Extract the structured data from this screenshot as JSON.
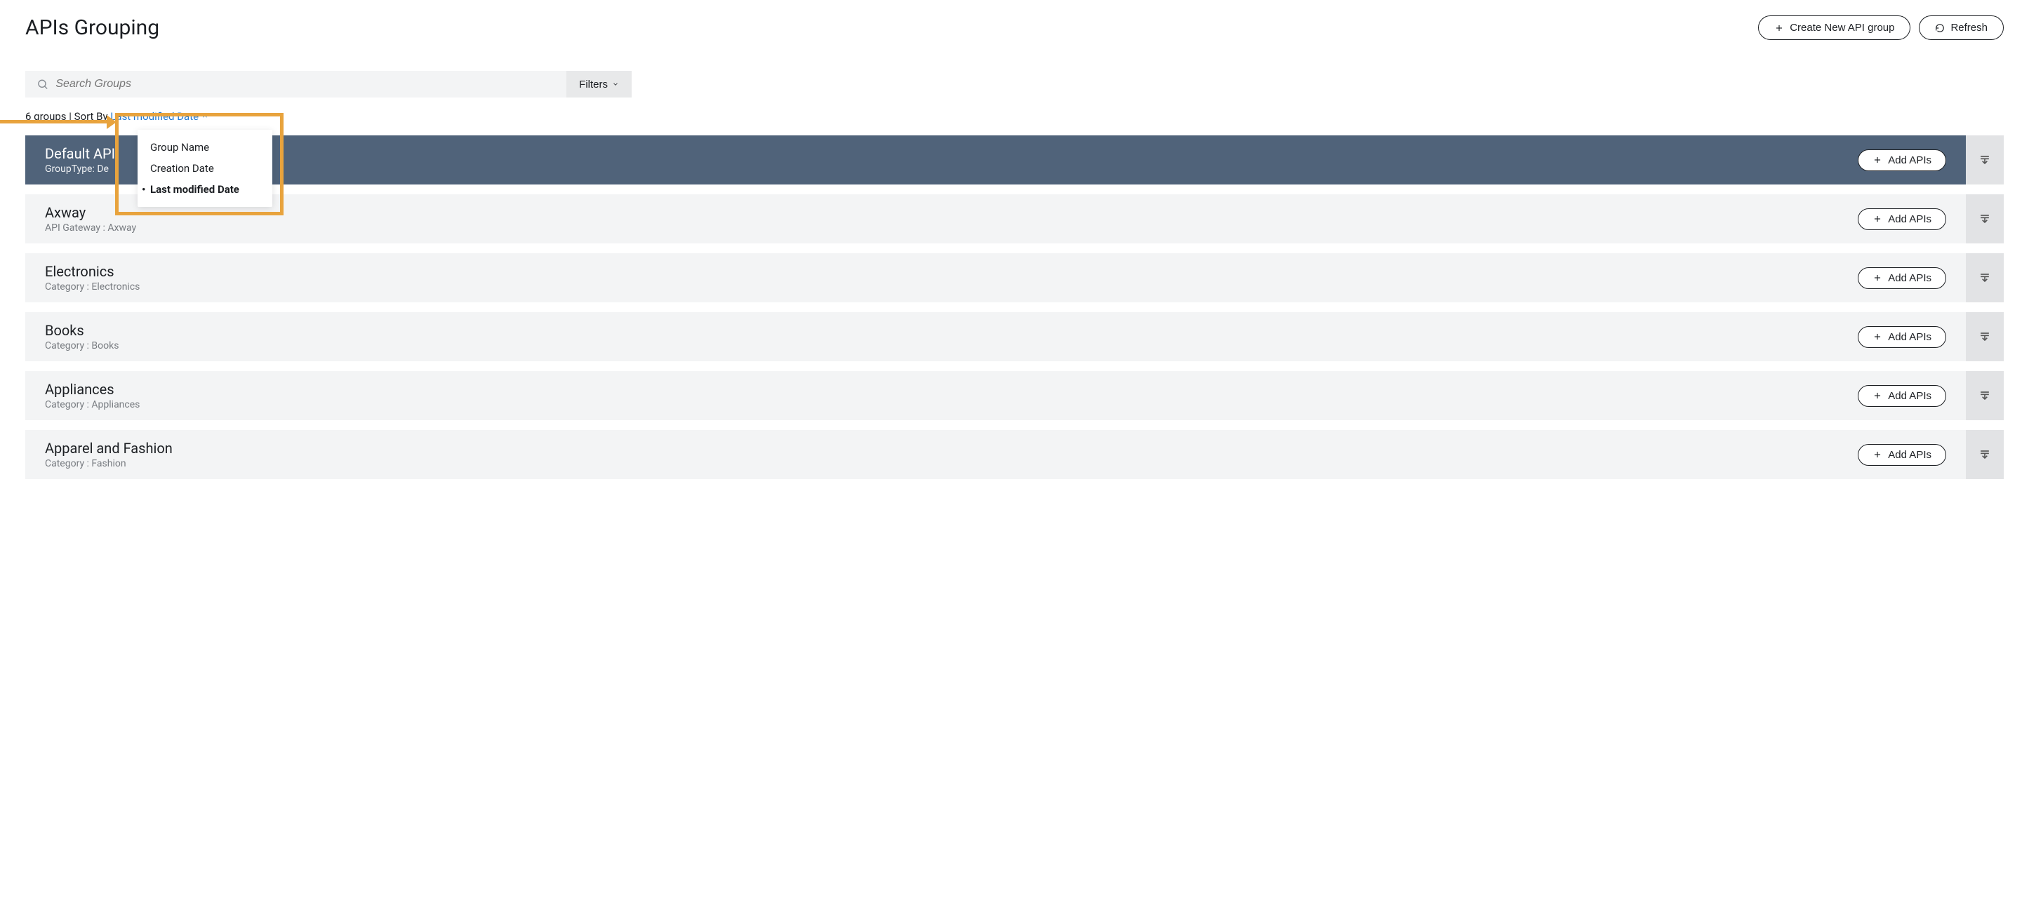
{
  "header": {
    "title": "APIs Grouping",
    "create_label": "Create New API group",
    "refresh_label": "Refresh"
  },
  "search": {
    "placeholder": "Search Groups",
    "filters_label": "Filters"
  },
  "sort": {
    "count_text": "6 groups | Sort By",
    "current": "Last modified Date",
    "options": [
      "Group Name",
      "Creation Date",
      "Last modified Date"
    ],
    "selected_index": 2
  },
  "groups": [
    {
      "title": "Default API",
      "sub": "GroupType: De",
      "active": true,
      "add_label": "Add APIs"
    },
    {
      "title": "Axway",
      "sub": "API Gateway : Axway",
      "active": false,
      "add_label": "Add APIs"
    },
    {
      "title": "Electronics",
      "sub": "Category : Electronics",
      "active": false,
      "add_label": "Add APIs"
    },
    {
      "title": "Books",
      "sub": "Category : Books",
      "active": false,
      "add_label": "Add APIs"
    },
    {
      "title": "Appliances",
      "sub": "Category : Appliances",
      "active": false,
      "add_label": "Add APIs"
    },
    {
      "title": "Apparel and Fashion",
      "sub": "Category : Fashion",
      "active": false,
      "add_label": "Add APIs"
    }
  ]
}
